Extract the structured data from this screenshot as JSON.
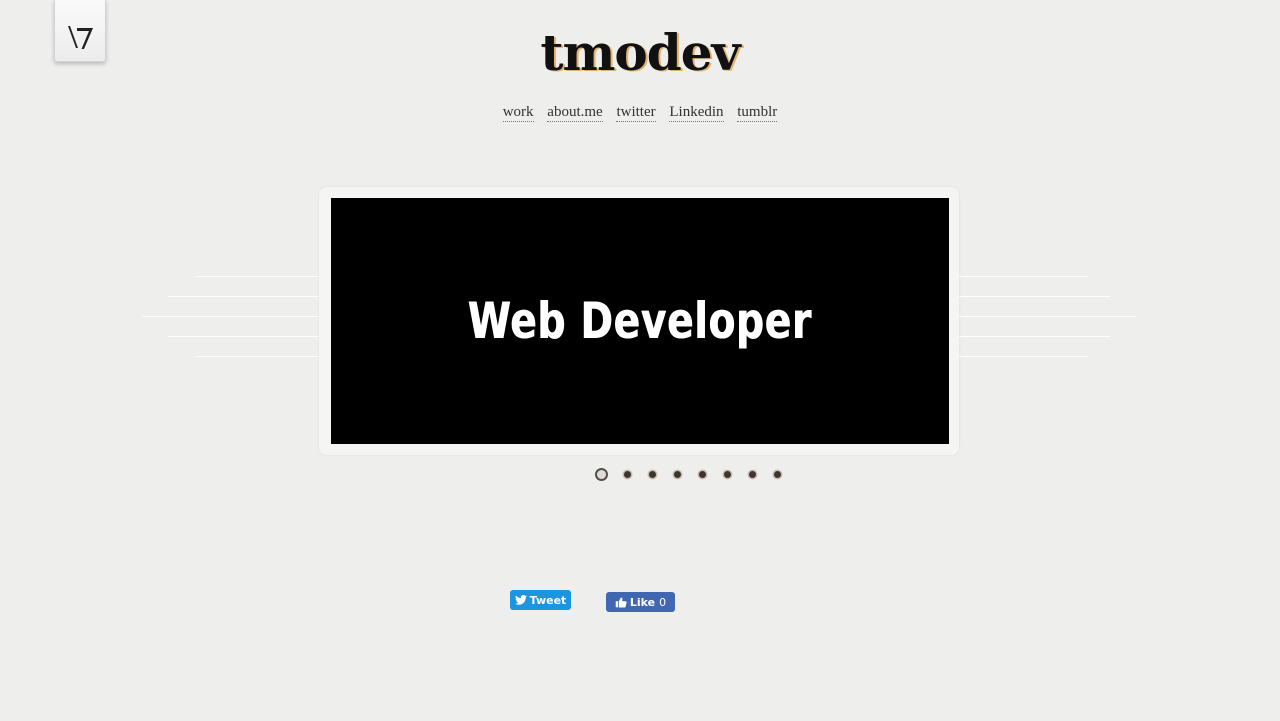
{
  "site": {
    "title": "tmodev",
    "logo_icon": "v7-logo-icon"
  },
  "nav": {
    "items": [
      {
        "label": "work"
      },
      {
        "label": "about.me"
      },
      {
        "label": "twitter"
      },
      {
        "label": "Linkedin"
      },
      {
        "label": "tumblr"
      }
    ]
  },
  "slider": {
    "current_slide_text": "Web Developer",
    "slide_count": 8,
    "active_index": 1
  },
  "social": {
    "tweet_label": "Tweet",
    "tweet_icon": "twitter-bird-icon",
    "like_label": "Like",
    "like_count": "0",
    "like_icon": "thumbs-up-icon"
  },
  "colors": {
    "background": "#eeeeed",
    "tweet_button": "#1b95e0",
    "like_button": "#4267b2",
    "title_shadow": "#e3b16e"
  }
}
